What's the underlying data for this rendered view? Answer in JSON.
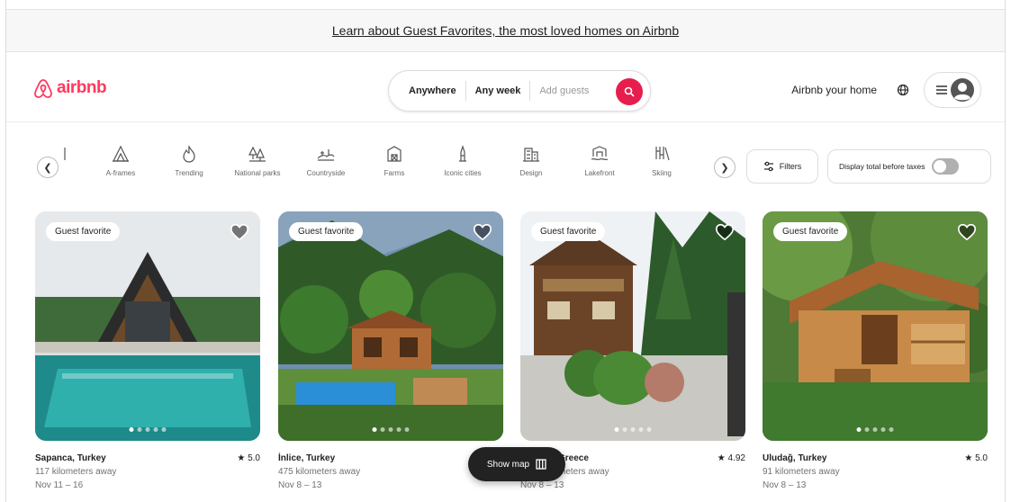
{
  "banner": {
    "text": "Learn about Guest Favorites, the most loved homes on Airbnb"
  },
  "header": {
    "logo_text": "airbnb",
    "search": {
      "location": "Anywhere",
      "dates": "Any week",
      "guests": "Add guests"
    },
    "host_link": "Airbnb your home"
  },
  "categories": [
    {
      "label": "",
      "icon": "partial-icon"
    },
    {
      "label": "A-frames",
      "icon": "a-frame-icon"
    },
    {
      "label": "Trending",
      "icon": "flame-icon"
    },
    {
      "label": "National parks",
      "icon": "national-park-icon"
    },
    {
      "label": "Countryside",
      "icon": "countryside-icon"
    },
    {
      "label": "Farms",
      "icon": "farm-icon"
    },
    {
      "label": "Iconic cities",
      "icon": "iconic-city-icon"
    },
    {
      "label": "Design",
      "icon": "design-icon"
    },
    {
      "label": "Lakefront",
      "icon": "lakefront-icon"
    },
    {
      "label": "Skiing",
      "icon": "skiing-icon"
    }
  ],
  "filters": {
    "label": "Filters"
  },
  "taxes_toggle": {
    "label": "Display total before taxes",
    "on": false
  },
  "listings": [
    {
      "badge": "Guest favorite",
      "location": "Sapanca, Turkey",
      "rating": "★ 5.0",
      "distance": "117 kilometers away",
      "dates": "Nov 11 – 16",
      "dots": 5,
      "active_dot": 0
    },
    {
      "badge": "Guest favorite",
      "location": "İnlice, Turkey",
      "rating": "",
      "distance": "475 kilometers away",
      "dates": "Nov 8 – 13",
      "dots": 5,
      "active_dot": 0
    },
    {
      "badge": "Guest favorite",
      "location": "Greece",
      "rating": "★ 4.92",
      "distance": "meters away",
      "dates": "Nov 8 – 13",
      "dots": 5,
      "active_dot": 0
    },
    {
      "badge": "Guest favorite",
      "location": "Uludağ, Turkey",
      "rating": "★ 5.0",
      "distance": "91 kilometers away",
      "dates": "Nov 8 – 13",
      "dots": 5,
      "active_dot": 0
    }
  ],
  "show_map": {
    "label": "Show map"
  },
  "colors": {
    "brand": "#ff385c",
    "search_button": "#e61e4d"
  }
}
